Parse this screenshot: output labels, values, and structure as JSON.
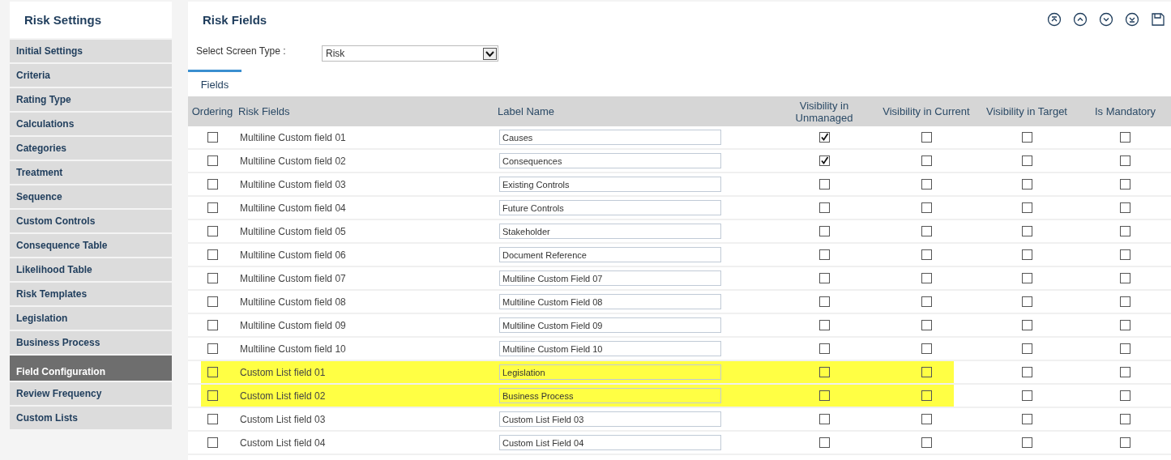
{
  "sidebar": {
    "title": "Risk Settings",
    "items": [
      {
        "label": "Initial Settings",
        "selected": false
      },
      {
        "label": "Criteria",
        "selected": false
      },
      {
        "label": "Rating Type",
        "selected": false
      },
      {
        "label": "Calculations",
        "selected": false
      },
      {
        "label": "Categories",
        "selected": false
      },
      {
        "label": "Treatment",
        "selected": false
      },
      {
        "label": "Sequence",
        "selected": false
      },
      {
        "label": "Custom Controls",
        "selected": false
      },
      {
        "label": "Consequence Table",
        "selected": false
      },
      {
        "label": "Likelihood Table",
        "selected": false
      },
      {
        "label": "Risk Templates",
        "selected": false
      },
      {
        "label": "Legislation",
        "selected": false
      },
      {
        "label": "Business Process",
        "selected": false
      },
      {
        "label": "Field Configuration",
        "selected": true
      },
      {
        "label": "Review Frequency",
        "selected": false
      },
      {
        "label": "Custom Lists",
        "selected": false
      }
    ]
  },
  "main": {
    "title": "Risk Fields",
    "toolbar": [
      {
        "kind": "top"
      },
      {
        "kind": "up"
      },
      {
        "kind": "down"
      },
      {
        "kind": "bottom"
      },
      {
        "kind": "save"
      }
    ],
    "screen_type": {
      "label": "Select Screen Type :",
      "value": "Risk"
    },
    "tabs": [
      {
        "label": "Fields",
        "selected": true
      }
    ],
    "table": {
      "columns": [
        "Ordering",
        "Risk Fields",
        "Label Name",
        "Visibility in Unmanaged",
        "Visibility in Current",
        "Visibility in Target",
        "Is Mandatory"
      ],
      "rows": [
        {
          "field": "Multiline Custom field 01",
          "label": "Causes",
          "highlighted": false,
          "ordering": false,
          "unmanaged": true,
          "current": false,
          "target": false,
          "mandatory": false
        },
        {
          "field": "Multiline Custom field 02",
          "label": "Consequences",
          "highlighted": false,
          "ordering": false,
          "unmanaged": true,
          "current": false,
          "target": false,
          "mandatory": false
        },
        {
          "field": "Multiline Custom field 03",
          "label": "Existing Controls",
          "highlighted": false,
          "ordering": false,
          "unmanaged": false,
          "current": false,
          "target": false,
          "mandatory": false
        },
        {
          "field": "Multiline Custom field 04",
          "label": "Future Controls",
          "highlighted": false,
          "ordering": false,
          "unmanaged": false,
          "current": false,
          "target": false,
          "mandatory": false
        },
        {
          "field": "Multiline Custom field 05",
          "label": "Stakeholder",
          "highlighted": false,
          "ordering": false,
          "unmanaged": false,
          "current": false,
          "target": false,
          "mandatory": false
        },
        {
          "field": "Multiline Custom field 06",
          "label": "Document Reference",
          "highlighted": false,
          "ordering": false,
          "unmanaged": false,
          "current": false,
          "target": false,
          "mandatory": false
        },
        {
          "field": "Multiline Custom field 07",
          "label": "Multiline Custom Field 07",
          "highlighted": false,
          "ordering": false,
          "unmanaged": false,
          "current": false,
          "target": false,
          "mandatory": false
        },
        {
          "field": "Multiline Custom field 08",
          "label": "Multiline Custom Field 08",
          "highlighted": false,
          "ordering": false,
          "unmanaged": false,
          "current": false,
          "target": false,
          "mandatory": false
        },
        {
          "field": "Multiline Custom field 09",
          "label": "Multiline Custom Field 09",
          "highlighted": false,
          "ordering": false,
          "unmanaged": false,
          "current": false,
          "target": false,
          "mandatory": false
        },
        {
          "field": "Multiline Custom field 10",
          "label": "Multiline Custom Field 10",
          "highlighted": false,
          "ordering": false,
          "unmanaged": false,
          "current": false,
          "target": false,
          "mandatory": false
        },
        {
          "field": "Custom List field 01",
          "label": "Legislation",
          "highlighted": true,
          "ordering": false,
          "unmanaged": false,
          "current": false,
          "target": false,
          "mandatory": false
        },
        {
          "field": "Custom List field 02",
          "label": "Business Process",
          "highlighted": true,
          "ordering": false,
          "unmanaged": false,
          "current": false,
          "target": false,
          "mandatory": false
        },
        {
          "field": "Custom List field 03",
          "label": "Custom List Field 03",
          "highlighted": false,
          "ordering": false,
          "unmanaged": false,
          "current": false,
          "target": false,
          "mandatory": false
        },
        {
          "field": "Custom List field 04",
          "label": "Custom List Field 04",
          "highlighted": false,
          "ordering": false,
          "unmanaged": false,
          "current": false,
          "target": false,
          "mandatory": false
        }
      ]
    }
  }
}
